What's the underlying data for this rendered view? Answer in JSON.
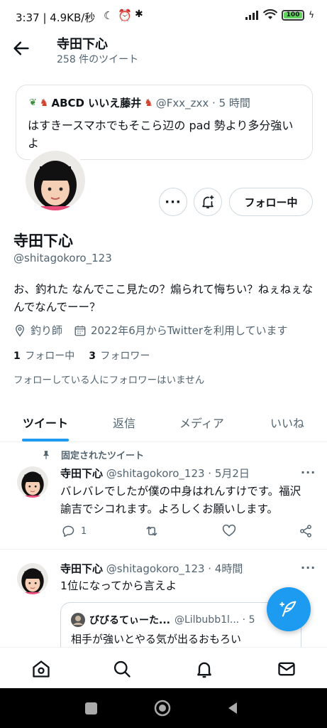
{
  "status_bar": {
    "time": "3:37 | 4.9KB/秒",
    "battery": "100"
  },
  "header": {
    "title": "寺田下心",
    "tweet_count": "258 件のツイート"
  },
  "banner": {
    "author_name": "ABCD いいえ藤井",
    "author_meta": "@Fxx_zxx · 5 時間",
    "text": "はすきースマホでもそこら辺の pad 勢より多分強いよ"
  },
  "profile": {
    "name": "寺田下心",
    "handle": "@shitagokoro_123",
    "bio": "お、釣れた なんでここ見たの？煽られて悔ちい？ねぇねぇなんでなんでーー？",
    "location": "釣り師",
    "joined": "2022年6月からTwitterを利用しています",
    "following_count": "1",
    "following_label": "フォロー中",
    "followers_count": "3",
    "followers_label": "フォロワー",
    "mutual_note": "フォローしている人にフォロワーはいません",
    "follow_button": "フォロー中"
  },
  "tabs": [
    {
      "label": "ツイート"
    },
    {
      "label": "返信"
    },
    {
      "label": "メディア"
    },
    {
      "label": "いいね"
    }
  ],
  "pinned_label": "固定されたツイート",
  "tweets": [
    {
      "name": "寺田下心",
      "meta": "@shitagokoro_123 · 5月2日",
      "text": "バレバレでしたが僕の中身はれんすけです。福沢諭吉でシコれます。よろしくお願いします。",
      "reply_count": "1"
    },
    {
      "name": "寺田下心",
      "meta": "@shitagokoro_123 · 4時間",
      "text": "1位になってから言えよ",
      "quote": {
        "name": "びびるてぃーた...",
        "meta": "@Lilbubb1l... · 5",
        "text": "相手が強いとやる気が出るおもろい"
      }
    }
  ],
  "colors": {
    "accent": "#1d9bf0",
    "muted": "#536471",
    "text": "#0f1419"
  }
}
